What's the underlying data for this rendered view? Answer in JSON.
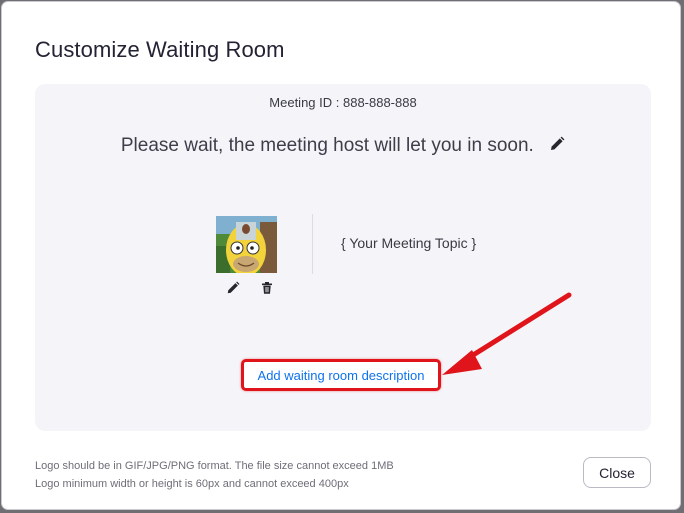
{
  "dialog": {
    "title": "Customize Waiting Room",
    "meeting_id": "Meeting ID : 888-888-888",
    "wait_message": "Please wait, the meeting host will let you in soon.",
    "meeting_topic": "{ Your Meeting Topic }",
    "add_description_label": "Add waiting room description",
    "logo_note_line1": "Logo should be in GIF/JPG/PNG format. The file size cannot exceed 1MB",
    "logo_note_line2": "Logo minimum width or height is 60px and cannot exceed 400px",
    "close_label": "Close"
  },
  "icons": {
    "edit_message": "pencil-icon",
    "edit_logo": "pencil-icon",
    "delete_logo": "trash-icon",
    "annotation": "red-arrow-annotation"
  },
  "colors": {
    "link": "#0e72ed",
    "annotation": "#e0151b",
    "panel": "#f5f5f9"
  }
}
